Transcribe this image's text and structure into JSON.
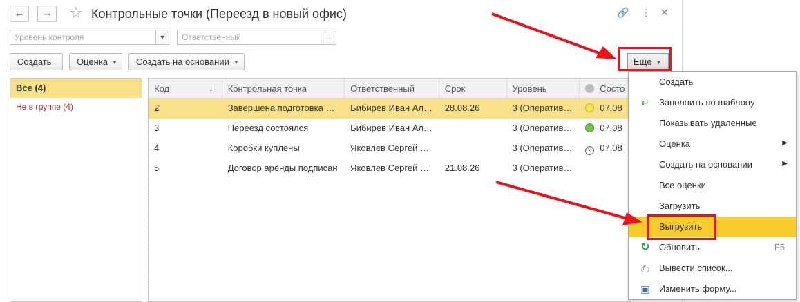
{
  "window": {
    "title": "Контрольные точки (Переезд в новый офис)"
  },
  "filters": {
    "level_placeholder": "Уровень контроля",
    "responsible_placeholder": "Ответственный",
    "dots": "..."
  },
  "toolbar": {
    "create": "Создать",
    "rating": "Оценка",
    "create_based_on": "Создать на основании",
    "more": "Еще"
  },
  "groups": [
    {
      "label": "Все (4)"
    },
    {
      "label": "Не в группе (4)"
    }
  ],
  "table": {
    "columns": [
      "Код",
      "Контрольная точка",
      "Ответственный",
      "Срок",
      "Уровень",
      "Состо"
    ],
    "rows": [
      {
        "code": "2",
        "point": "Завершена подготовка …",
        "responsible": "Бибирев Иван Ал…",
        "deadline": "28.08.26",
        "level": "3 (Оператив…",
        "state_date": "07.08",
        "state": "yellow"
      },
      {
        "code": "3",
        "point": "Переезд состоялся",
        "responsible": "Бибирев Иван Ал…",
        "deadline": "",
        "level": "3 (Оператив…",
        "state_date": "07.08",
        "state": "green"
      },
      {
        "code": "4",
        "point": "Коробки куплены",
        "responsible": "Яковлев Сергей …",
        "deadline": "",
        "level": "3 (Оператив…",
        "state_date": "07.08",
        "state": "question"
      },
      {
        "code": "5",
        "point": "Договор аренды подписан",
        "responsible": "Яковлев Сергей …",
        "deadline": "21.08.26",
        "level": "3 (Оператив…",
        "state_date": "",
        "state": "none"
      }
    ]
  },
  "menu": {
    "items": [
      {
        "label": "Создать"
      },
      {
        "label": "Заполнить по шаблону"
      },
      {
        "label": "Показывать удаленные"
      },
      {
        "label": "Оценка"
      },
      {
        "label": "Создать на основании"
      },
      {
        "label": "Все оценки"
      },
      {
        "label": "Загрузить"
      },
      {
        "label": "Выгрузить"
      },
      {
        "label": "Обновить",
        "shortcut": "F5"
      },
      {
        "label": "Вывести список..."
      },
      {
        "label": "Изменить форму..."
      }
    ]
  },
  "colors": {
    "selection": "#fbe08a",
    "menu_highlight": "#f8cb2a",
    "annotation": "#e8141b"
  }
}
